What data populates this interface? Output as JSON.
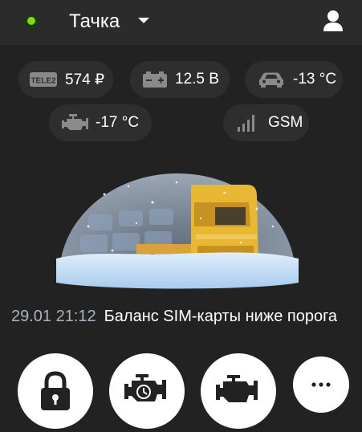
{
  "header": {
    "title": "Тачка",
    "status_color": "#8bd41e",
    "status_icon": "online-dot-icon",
    "dropdown_icon": "caret-down-icon",
    "account_icon": "user-icon"
  },
  "indicators": [
    {
      "icon": "tele2-icon",
      "icon_text": "TELE2",
      "value": "574 ₽"
    },
    {
      "icon": "battery-icon",
      "value": "12.5 В"
    },
    {
      "icon": "car-icon",
      "value": "-13 °C"
    },
    {
      "icon": "engine-icon",
      "value": "-17 °C"
    },
    {
      "icon": "signal-icon",
      "value": "GSM"
    }
  ],
  "vehicle_image": {
    "icon": "truck-under-snow-dome-icon"
  },
  "event": {
    "time": "29.01 21:12",
    "message": "Баланс SIM-карты ниже порога"
  },
  "actions": [
    {
      "name": "lock",
      "icon": "lock-icon"
    },
    {
      "name": "engine-start-timer",
      "icon": "engine-timer-icon"
    },
    {
      "name": "engine",
      "icon": "engine-icon"
    },
    {
      "name": "more",
      "icon": "more-dots-icon"
    }
  ],
  "colors": {
    "background": "#222222",
    "header": "#2b2b2b",
    "pill": "#2e2e2e",
    "accent_green": "#8bd41e",
    "truck_yellow": "#e8b733",
    "time_text": "#a9b4bf"
  }
}
